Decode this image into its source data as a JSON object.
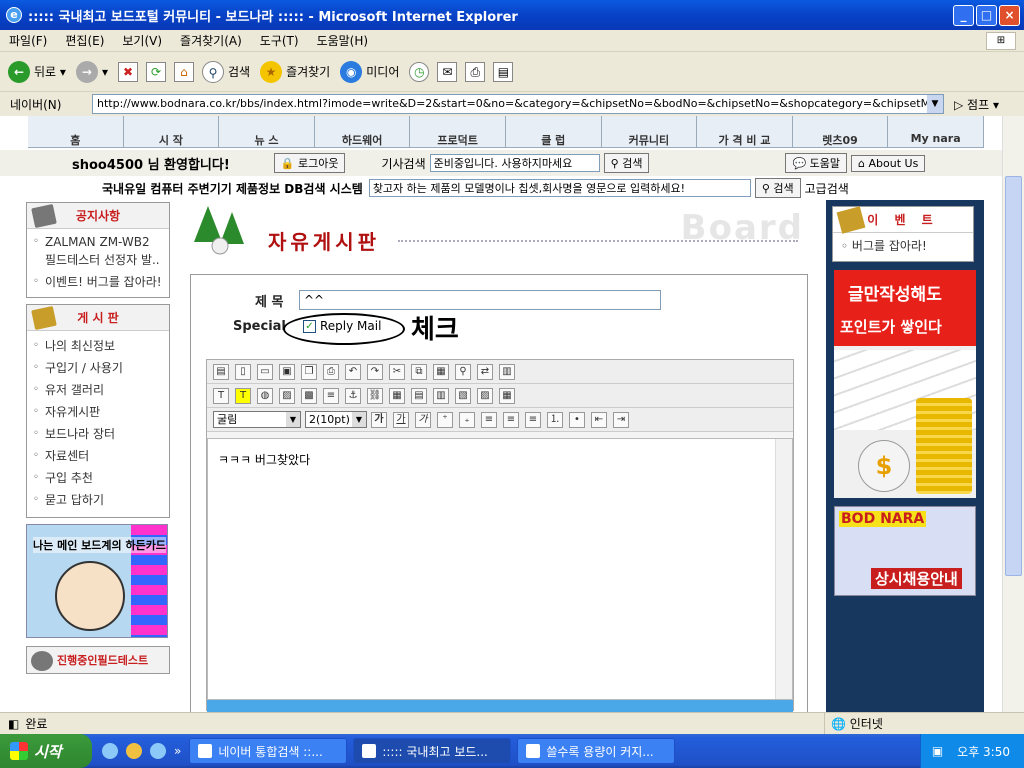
{
  "window": {
    "title": "::::: 국내최고 보드포털 커뮤니티 - 보드나라 ::::: - Microsoft Internet Explorer"
  },
  "menu": [
    "파일(F)",
    "편집(E)",
    "보기(V)",
    "즐겨찾기(A)",
    "도구(T)",
    "도움말(H)"
  ],
  "toolbar": {
    "back": "뒤로",
    "search": "검색",
    "favorites": "즐겨찾기",
    "media": "미디어"
  },
  "address": {
    "label": "네이버(N)",
    "url": "http://www.bodnara.co.kr/bbs/index.html?imode=write&D=2&start=0&no=&category=&chipsetNo=&bodNo=&chipsetNo=&shopcategory=&chipsetMa",
    "go": "점프"
  },
  "nav": [
    "홈",
    "시 작",
    "뉴 스",
    "하드웨어",
    "프로덕트",
    "클 럽",
    "커뮤니티",
    "가 격 비 교",
    "렛츠09",
    "My nara"
  ],
  "welcome": {
    "text": "shoo4500 님 환영합니다!",
    "logout": "로그아웃",
    "search_label": "기사검색",
    "search_value": "준비중입니다. 사용하지마세요",
    "search_btn": "검색",
    "help": "도움말",
    "about": "About Us"
  },
  "product": {
    "label": "국내유일 컴퓨터 주변기기 제품정보 DB검색 시스템",
    "placeholder": "찾고자 하는 제품의 모델명이나 칩셋,회사명을 영문으로 입력하세요!",
    "search_btn": "검색",
    "advanced": "고급검색"
  },
  "notice": {
    "title": "공지사항",
    "items": [
      "ZALMAN ZM-WB2 필드테스터 선정자 발..",
      "이벤트! 버그를 잡아라!"
    ]
  },
  "boardmenu": {
    "title": "게 시 판",
    "items": [
      "나의 최신정보",
      "구입기 / 사용기",
      "유저 갤러리",
      "자유게시판",
      "보드나라 장터",
      "자료센터",
      "구입 추천",
      "묻고 답하기"
    ]
  },
  "promo": {
    "text": "나는 메인 보드계의 하든카드"
  },
  "fieldtest": {
    "title": "진행중인필드테스트"
  },
  "board": {
    "title": "자유게시판",
    "watermark": "Board"
  },
  "form": {
    "subject_label": "제 목",
    "subject_value": "^^",
    "special_label": "Special",
    "reply_mail": "Reply Mail",
    "handwritten": "체크"
  },
  "editor": {
    "font": "굴림",
    "size": "2(10pt)",
    "content": "ㅋㅋㅋ 버그찾았다"
  },
  "event": {
    "title": "이 벤 트",
    "item": "버그를 잡아라!"
  },
  "banner1": {
    "line1": "글만작성해도",
    "line2": "포인트가 쌓인다"
  },
  "banner2": {
    "brand": "BOD NARA",
    "slogan": "상시채용안내"
  },
  "status": {
    "text": "완료",
    "zone": "인터넷"
  },
  "taskbar": {
    "start": "시작",
    "tasks": [
      "네이버 통합검색 ::...",
      "::::: 국내최고 보드...",
      "쓸수록 용량이 커지..."
    ],
    "clock": "오후 3:50"
  }
}
